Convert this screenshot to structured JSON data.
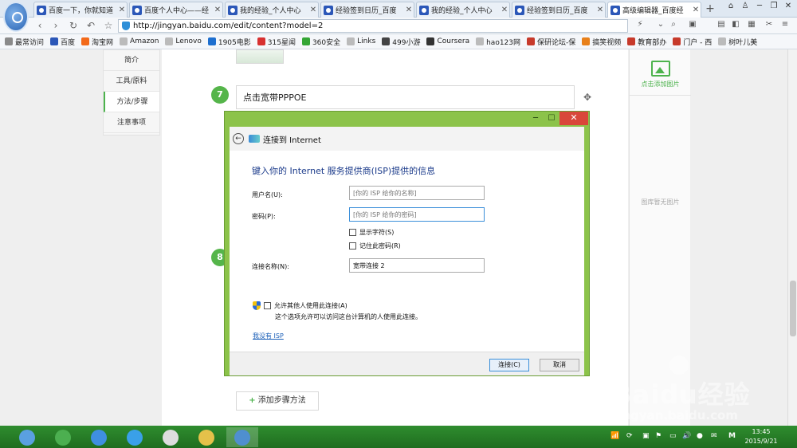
{
  "tabs": [
    {
      "title": "百度一下，你就知道"
    },
    {
      "title": "百度个人中心——经"
    },
    {
      "title": "我的经验_个人中心"
    },
    {
      "title": "经验签到日历_百度"
    },
    {
      "title": "我的经验_个人中心"
    },
    {
      "title": "经验签到日历_百度"
    },
    {
      "title": "高级编辑器_百度经"
    }
  ],
  "tab_close": "✕",
  "new_tab": "+",
  "window_controls": {
    "minimize": "─",
    "maximize": "❐",
    "close": "✕"
  },
  "address": {
    "url": "http://jingyan.baidu.com/edit/content?model=2"
  },
  "bookmarks": [
    {
      "label": "最常访问",
      "color": "#8a8a8a"
    },
    {
      "label": "百度",
      "color": "#2b57b8"
    },
    {
      "label": "淘宝网",
      "color": "#f36a1b"
    },
    {
      "label": "Amazon",
      "color": "#bbbbbb"
    },
    {
      "label": "Lenovo",
      "color": "#bbbbbb"
    },
    {
      "label": "1905电影",
      "color": "#1e6fcf"
    },
    {
      "label": "315星闻",
      "color": "#d83030"
    },
    {
      "label": "360安全",
      "color": "#35a635"
    },
    {
      "label": "Links",
      "color": "#bbbbbb"
    },
    {
      "label": "499小游",
      "color": "#444444"
    },
    {
      "label": "Coursera",
      "color": "#333333"
    },
    {
      "label": "hao123网",
      "color": "#bbbbbb"
    },
    {
      "label": "保研论坛-保",
      "color": "#c73a2b"
    },
    {
      "label": "搞笑视频",
      "color": "#e8801a"
    },
    {
      "label": "教育部办",
      "color": "#c73a2b"
    },
    {
      "label": "门户 - 西",
      "color": "#c73a2b"
    },
    {
      "label": "树叶儿美",
      "color": "#bbbbbb"
    }
  ],
  "left_nav": [
    {
      "label": "简介",
      "active": false
    },
    {
      "label": "工具/原料",
      "active": false
    },
    {
      "label": "方法/步骤",
      "active": true
    },
    {
      "label": "注意事项",
      "active": false
    }
  ],
  "steps": {
    "step7": {
      "number": "7",
      "text": "点击宽带PPPOE"
    },
    "step8": {
      "number": "8"
    },
    "add_step": "添加步骤方法",
    "plus": "+"
  },
  "right_panel": {
    "add_image": "点击添加图片",
    "empty": "图库暂无图片"
  },
  "dialog": {
    "title": "连接到 Internet",
    "instruction": "键入你的 Internet 服务提供商(ISP)提供的信息",
    "username_label": "用户名(U):",
    "username_placeholder": "[你的 ISP 给你的名称]",
    "password_label": "密码(P):",
    "password_placeholder": "[你的 ISP 给你的密码]",
    "show_chars": "显示字符(S)",
    "remember_pw": "记住此密码(R)",
    "conn_name_label": "连接名称(N):",
    "conn_name_value": "宽带连接 2",
    "allow_others": "允许其他人使用此连接(A)",
    "allow_hint": "这个选项允许可以访问这台计算机的人使用此连接。",
    "no_isp_link": "我没有 ISP",
    "connect_button": "连接(C)",
    "cancel_button": "取消",
    "minimize": "─",
    "maximize": "☐",
    "close": "✕"
  },
  "watermark": {
    "brand": "Baidu经验",
    "domain": "jingyan.baidu.com"
  },
  "taskbar": {
    "apps": [
      {
        "name": "app-1",
        "color": "#5aa0e0"
      },
      {
        "name": "utorrent",
        "color": "#4caf50"
      },
      {
        "name": "ie",
        "color": "#3f8fe0"
      },
      {
        "name": "app-4",
        "color": "#3aa0e8"
      },
      {
        "name": "app-5",
        "color": "#dddddd"
      },
      {
        "name": "explorer",
        "color": "#e5c14a"
      },
      {
        "name": "control-panel",
        "color": "#4f8fcf"
      }
    ],
    "clock_time": "13:45",
    "clock_date": "2015/9/21",
    "ime": "M"
  }
}
